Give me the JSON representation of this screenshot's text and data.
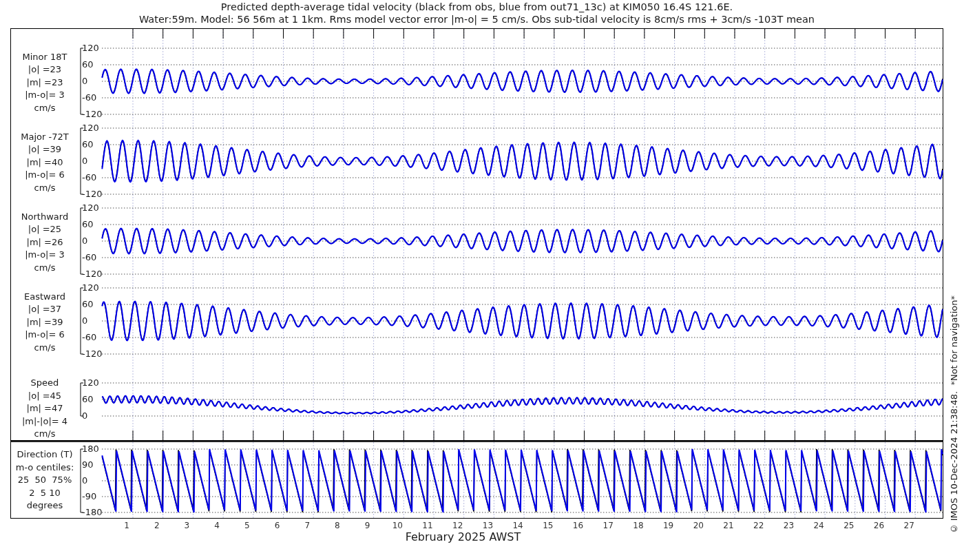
{
  "title": [
    "Predicted depth-average tidal velocity (black from obs, blue from out71_13c) at KIM050 16.4S 121.6E.",
    "Water:59m. Model: 56 56m at 1 1km. Rms model vector error |m-o| = 5 cm/s. Obs sub-tidal velocity is 8cm/s rms + 3cm/s -103T mean"
  ],
  "panels": [
    {
      "kind": "velocity",
      "label_lines": [
        "Minor 18T",
        "|o| =23",
        "|m| =23",
        "|m-o|= 3",
        "cm/s"
      ],
      "yticks": [
        "120",
        "60",
        "0",
        "-60",
        "-120"
      ]
    },
    {
      "kind": "velocity",
      "label_lines": [
        "Major -72T",
        "|o| =39",
        "|m| =40",
        "|m-o|= 6",
        "cm/s"
      ],
      "yticks": [
        "120",
        "60",
        "0",
        "-60",
        "-120"
      ]
    },
    {
      "kind": "velocity",
      "label_lines": [
        "Northward",
        "|o| =25",
        "|m| =26",
        "|m-o|= 3",
        "cm/s"
      ],
      "yticks": [
        "120",
        "60",
        "0",
        "-60",
        "-120"
      ]
    },
    {
      "kind": "velocity",
      "label_lines": [
        "Eastward",
        "|o| =37",
        "|m| =39",
        "|m-o|= 6",
        "cm/s"
      ],
      "yticks": [
        "120",
        "60",
        "0",
        "-60",
        "-120"
      ]
    },
    {
      "kind": "speed",
      "label_lines": [
        "Speed",
        "|o| =45",
        "|m| =47",
        "|m|-|o|= 4",
        "cm/s"
      ],
      "yticks": [
        "120",
        "60",
        "0"
      ]
    },
    {
      "kind": "direction",
      "label_lines": [
        "Direction (T)",
        "m-o centiles:",
        "25  50  75%",
        "2  5 10",
        "degrees"
      ],
      "yticks": [
        "180",
        "90",
        "0",
        "-90",
        "-180"
      ]
    }
  ],
  "xticks": [
    "1",
    "2",
    "3",
    "4",
    "5",
    "6",
    "7",
    "8",
    "9",
    "10",
    "11",
    "12",
    "13",
    "14",
    "15",
    "16",
    "17",
    "18",
    "19",
    "20",
    "21",
    "22",
    "23",
    "24",
    "25",
    "26",
    "27"
  ],
  "xlabel": "February 2025 AWST",
  "footer": "© IMOS 10-Dec-2024 21:38:48.  *Not for navigation*"
}
